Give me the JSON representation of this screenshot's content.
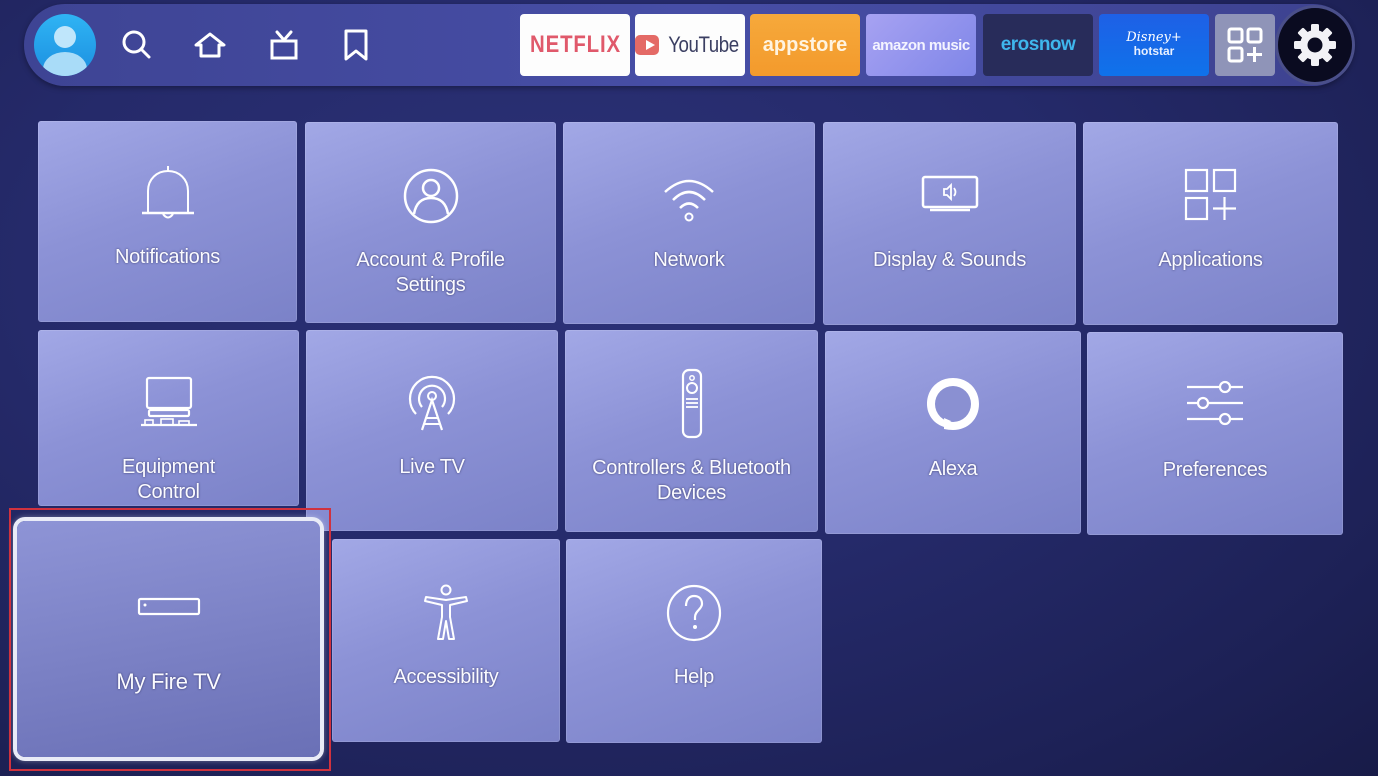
{
  "topbar": {
    "profile": {
      "icon": "user-avatar-icon"
    },
    "nav": [
      {
        "name": "search",
        "icon": "search-icon"
      },
      {
        "name": "home",
        "icon": "home-icon"
      },
      {
        "name": "live",
        "icon": "tv-icon"
      },
      {
        "name": "watchlist",
        "icon": "bookmark-icon"
      }
    ],
    "apps": [
      {
        "id": "netflix",
        "label": "NETFLIX"
      },
      {
        "id": "youtube",
        "label": "YouTube"
      },
      {
        "id": "appstore",
        "label": "appstore"
      },
      {
        "id": "amazon_music",
        "label": "amazon music"
      },
      {
        "id": "erosnow",
        "label": "erosnow"
      },
      {
        "id": "hotstar",
        "label_top": "Disney+",
        "label_bottom": "hotstar"
      }
    ],
    "more_apps": {
      "icon": "apps-grid-plus-icon"
    },
    "settings": {
      "icon": "gear-icon",
      "selected": true
    }
  },
  "settings_grid": [
    {
      "id": "notifications",
      "label": "Notifications",
      "icon": "bell-icon"
    },
    {
      "id": "account",
      "label": "Account & Profile Settings",
      "line1": "Account & Profile",
      "line2": "Settings",
      "icon": "user-circle-icon"
    },
    {
      "id": "network",
      "label": "Network",
      "icon": "wifi-icon"
    },
    {
      "id": "display",
      "label": "Display & Sounds",
      "icon": "display-speaker-icon"
    },
    {
      "id": "applications",
      "label": "Applications",
      "icon": "apps-grid-plus-icon"
    },
    {
      "id": "equipment",
      "label": "Equipment Control",
      "line1": "Equipment",
      "line2": "Control",
      "icon": "tv-equipment-icon"
    },
    {
      "id": "livetv",
      "label": "Live TV",
      "icon": "antenna-icon"
    },
    {
      "id": "controllers",
      "label": "Controllers & Bluetooth Devices",
      "line1": "Controllers & Bluetooth",
      "line2": "Devices",
      "icon": "remote-icon"
    },
    {
      "id": "alexa",
      "label": "Alexa",
      "icon": "alexa-icon"
    },
    {
      "id": "preferences",
      "label": "Preferences",
      "icon": "sliders-icon"
    },
    {
      "id": "myfiretv",
      "label": "My Fire TV",
      "icon": "fire-tv-device-icon",
      "focused": true
    },
    {
      "id": "accessibility",
      "label": "Accessibility",
      "icon": "accessibility-icon"
    },
    {
      "id": "help",
      "label": "Help",
      "icon": "help-icon"
    }
  ],
  "annotation": {
    "highlighted_item": "My Fire TV",
    "color": "#d0323e"
  }
}
